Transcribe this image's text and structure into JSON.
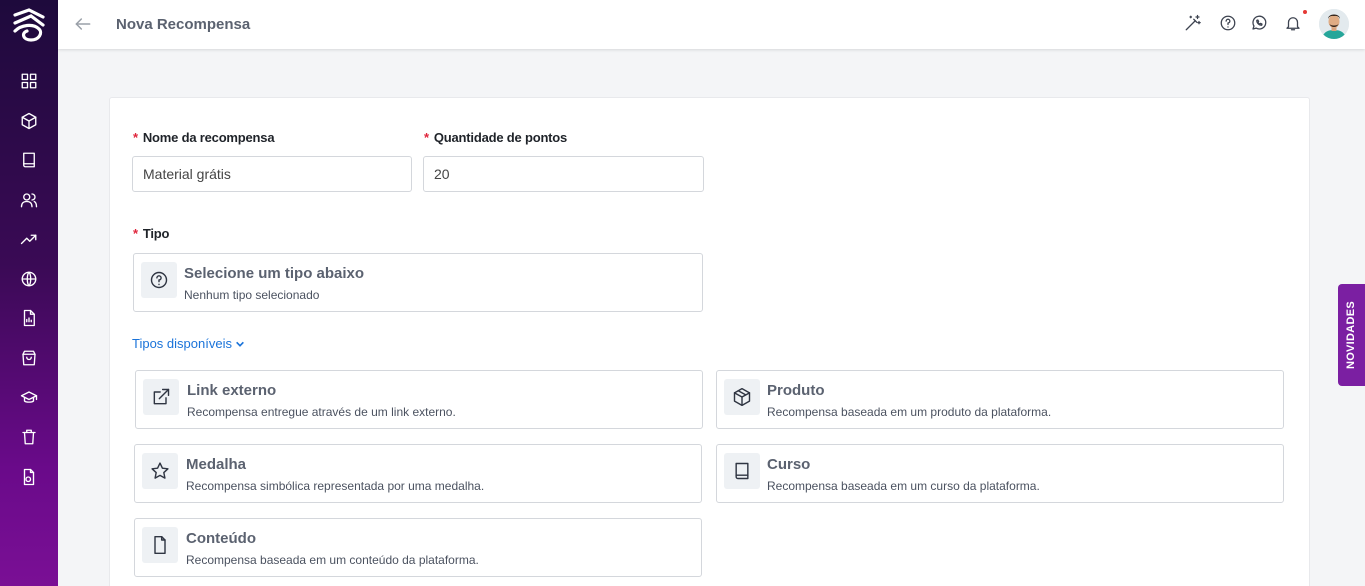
{
  "header": {
    "title": "Nova Recompensa"
  },
  "form": {
    "name_label": "Nome da recompensa",
    "name_value": "Material grátis",
    "points_label": "Quantidade de pontos",
    "points_value": "20",
    "type_label": "Tipo",
    "required_mark": "*",
    "selected_type": {
      "title": "Selecione um tipo abaixo",
      "subtitle": "Nenhum tipo selecionado"
    },
    "available_toggle": "Tipos disponíveis"
  },
  "options": [
    {
      "title": "Link externo",
      "desc": "Recompensa entregue através de um link externo.",
      "icon": "external-link-icon"
    },
    {
      "title": "Produto",
      "desc": "Recompensa baseada em um produto da plataforma.",
      "icon": "box-icon"
    },
    {
      "title": "Medalha",
      "desc": "Recompensa simbólica representada por uma medalha.",
      "icon": "star-icon"
    },
    {
      "title": "Curso",
      "desc": "Recompensa baseada em um curso da plataforma.",
      "icon": "book-icon"
    },
    {
      "title": "Conteúdo",
      "desc": "Recompensa baseada em um conteúdo da plataforma.",
      "icon": "file-icon"
    }
  ],
  "side_tab": "NOVIDADES",
  "colors": {
    "sidebar_top": "#1e0a3c",
    "sidebar_bottom": "#7a0f95",
    "link": "#1a73d9",
    "required": "#e0243b",
    "side_tab": "#7b1fa2"
  }
}
